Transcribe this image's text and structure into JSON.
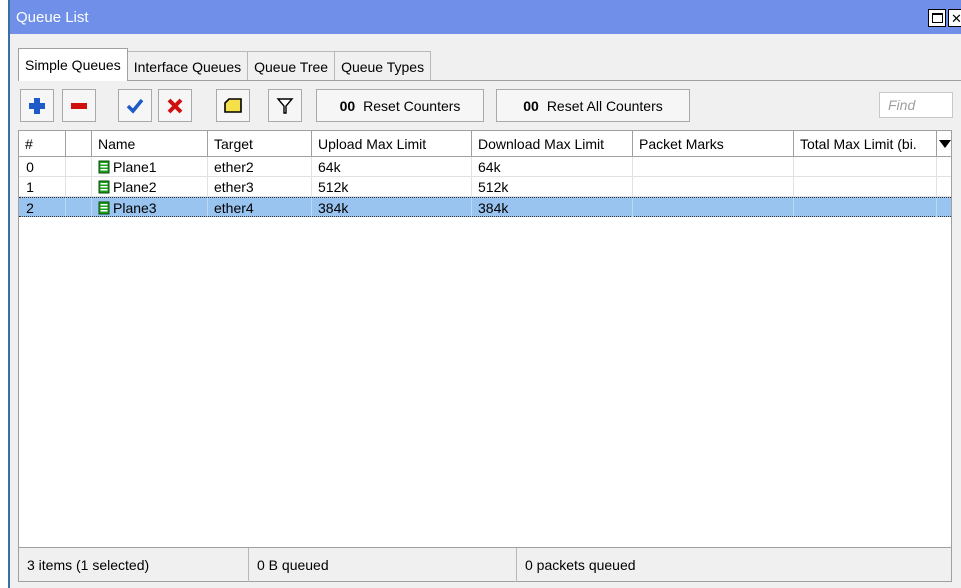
{
  "window": {
    "title": "Queue List"
  },
  "tabs": [
    {
      "label": "Simple Queues",
      "active": true
    },
    {
      "label": "Interface Queues",
      "active": false
    },
    {
      "label": "Queue Tree",
      "active": false
    },
    {
      "label": "Queue Types",
      "active": false
    }
  ],
  "toolbar": {
    "icons": [
      "add-icon",
      "remove-icon",
      "enable-check-icon",
      "disable-x-icon",
      "comment-icon",
      "filter-icon"
    ],
    "reset_counters_prefix": "00",
    "reset_counters_label": "Reset Counters",
    "reset_all_counters_prefix": "00",
    "reset_all_counters_label": "Reset All Counters",
    "find_placeholder": "Find"
  },
  "table": {
    "columns": [
      "#",
      "Name",
      "Target",
      "Upload Max Limit",
      "Download Max Limit",
      "Packet Marks",
      "Total Max Limit (bi."
    ],
    "rows": [
      {
        "num": "0",
        "name": "Plane1",
        "target": "ether2",
        "upload": "64k",
        "download": "64k",
        "marks": "",
        "total": ""
      },
      {
        "num": "1",
        "name": "Plane2",
        "target": "ether3",
        "upload": "512k",
        "download": "512k",
        "marks": "",
        "total": ""
      },
      {
        "num": "2",
        "name": "Plane3",
        "target": "ether4",
        "upload": "384k",
        "download": "384k",
        "marks": "",
        "total": "",
        "selected": true
      }
    ]
  },
  "status": {
    "items": "3 items (1 selected)",
    "bytes_queued": "0 B queued",
    "packets_queued": "0 packets queued"
  },
  "colors": {
    "titlebar": "#6f8fe8",
    "selected_row": "#99c4ef",
    "add_icon": "#1e5bc6",
    "remove_icon": "#d01010",
    "queue_icon": "#1e9e1e"
  }
}
